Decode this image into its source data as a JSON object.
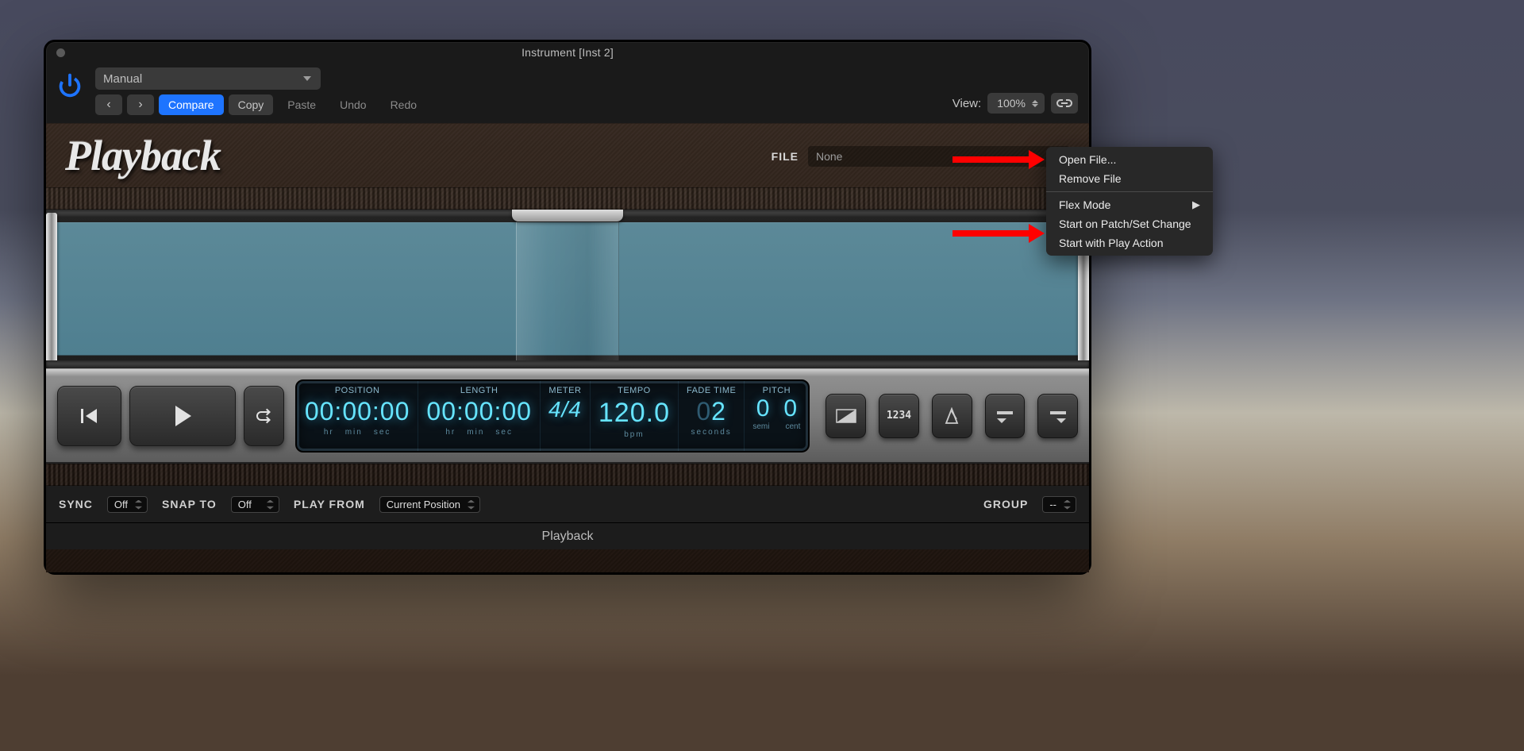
{
  "titlebar": {
    "text": "Instrument [Inst 2]"
  },
  "toolbar": {
    "preset": "Manual",
    "nav_prev": "‹",
    "nav_next": "›",
    "compare": "Compare",
    "copy": "Copy",
    "paste": "Paste",
    "undo": "Undo",
    "redo": "Redo",
    "view_label": "View:",
    "zoom": "100%"
  },
  "plugin": {
    "logo": "Playback",
    "file_label": "FILE",
    "file_value": "None"
  },
  "transport": {
    "position": {
      "label": "POSITION",
      "value": "00:00:00",
      "sub": [
        "hr",
        "min",
        "sec"
      ]
    },
    "length": {
      "label": "LENGTH",
      "value": "00:00:00",
      "sub": [
        "hr",
        "min",
        "sec"
      ]
    },
    "meter": {
      "label": "METER",
      "value": "4/4"
    },
    "tempo": {
      "label": "TEMPO",
      "value": "120.0",
      "sub": "bpm"
    },
    "fade": {
      "label": "FADE TIME",
      "value_dim": "0",
      "value": "2",
      "sub": "seconds"
    },
    "pitch": {
      "label": "PITCH",
      "semi": "0",
      "cent": "0",
      "sub_semi": "semi",
      "sub_cent": "cent"
    },
    "count_in_label": "1234"
  },
  "options": {
    "sync_label": "SYNC",
    "sync_value": "Off",
    "snap_label": "SNAP TO",
    "snap_value": "Off",
    "playfrom_label": "PLAY FROM",
    "playfrom_value": "Current Position",
    "group_label": "GROUP",
    "group_value": "--"
  },
  "footer": {
    "name": "Playback"
  },
  "context_menu": {
    "open_file": "Open File...",
    "remove_file": "Remove File",
    "flex_mode": "Flex Mode",
    "start_patch": "Start on Patch/Set Change",
    "start_play": "Start with Play Action"
  }
}
